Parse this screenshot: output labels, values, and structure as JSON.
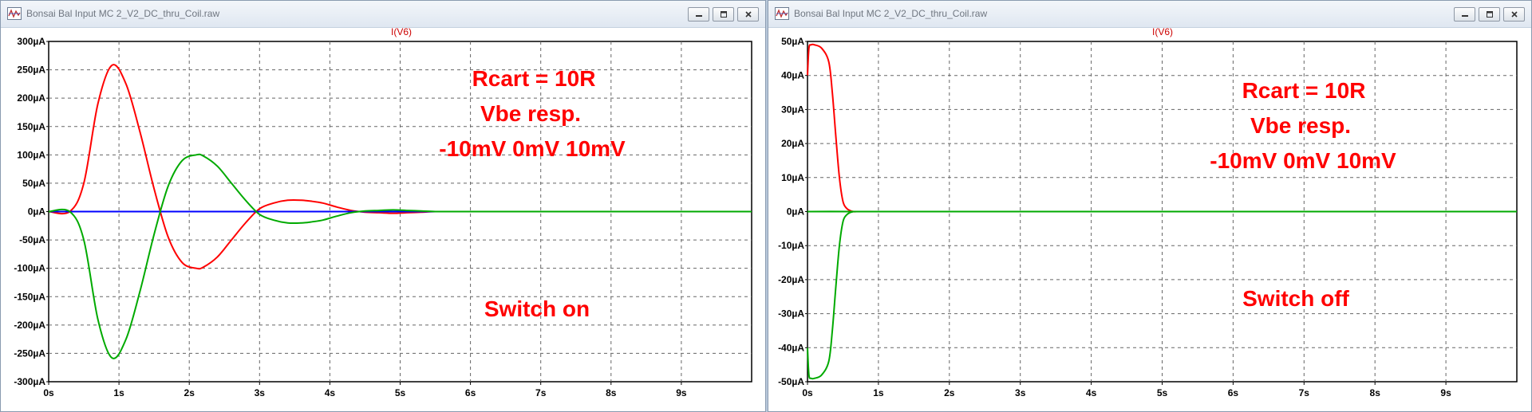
{
  "windows": [
    {
      "id": "left",
      "title": "Bonsai Bal Input MC 2_V2_DC_thru_Coil.raw",
      "trace": "I(V6)",
      "annotations": {
        "line1": "Rcart = 10R",
        "line2": "Vbe resp.",
        "line3": "-10mV  0mV 10mV",
        "state": "Switch on"
      },
      "chart_data": {
        "type": "line",
        "title": "I(V6)",
        "xlabel": "",
        "ylabel": "",
        "xlim": [
          0,
          10
        ],
        "ylim": [
          -300,
          300
        ],
        "grid": true,
        "x_ticks": [
          "0s",
          "1s",
          "2s",
          "3s",
          "4s",
          "5s",
          "6s",
          "7s",
          "8s",
          "9s"
        ],
        "y_ticks": [
          "300µA",
          "250µA",
          "200µA",
          "150µA",
          "100µA",
          "50µA",
          "0µA",
          "-50µA",
          "-100µA",
          "-150µA",
          "-200µA",
          "-250µA",
          "-300µA"
        ],
        "series": [
          {
            "color": "#ff0000",
            "x": [
              0,
              0.3,
              0.5,
              0.7,
              0.9,
              1.1,
              1.3,
              1.5,
              1.7,
              1.9,
              2.1,
              2.2,
              2.4,
              2.6,
              2.8,
              3.0,
              3.2,
              3.4,
              3.6,
              3.75,
              3.9,
              4.1,
              4.3,
              4.5,
              4.7,
              4.9,
              5.1,
              5.3,
              5.5,
              5.7,
              5.95
            ],
            "values": [
              0,
              0,
              50,
              190,
              258,
              225,
              140,
              40,
              -45,
              -90,
              -100,
              -98,
              -80,
              -50,
              -20,
              5,
              15,
              20,
              20,
              18,
              15,
              8,
              2,
              -1,
              -2,
              -3,
              -2,
              -1,
              0,
              0,
              0
            ]
          },
          {
            "color": "#0000ff",
            "x": [
              0,
              10
            ],
            "values": [
              0,
              0
            ]
          },
          {
            "color": "#00aa00",
            "x": [
              0,
              0.3,
              0.5,
              0.7,
              0.9,
              1.1,
              1.3,
              1.5,
              1.7,
              1.9,
              2.1,
              2.2,
              2.4,
              2.6,
              2.8,
              3.0,
              3.2,
              3.4,
              3.6,
              3.75,
              3.9,
              4.1,
              4.3,
              4.5,
              4.7,
              4.9,
              5.1,
              5.3,
              5.5,
              5.7,
              5.95,
              10
            ],
            "values": [
              0,
              0,
              -50,
              -190,
              -258,
              -225,
              -140,
              -40,
              45,
              90,
              100,
              98,
              80,
              50,
              20,
              -5,
              -15,
              -20,
              -20,
              -18,
              -15,
              -8,
              -2,
              1,
              2,
              3,
              2,
              1,
              0,
              0,
              0,
              0
            ]
          }
        ]
      }
    },
    {
      "id": "right",
      "title": "Bonsai Bal Input MC 2_V2_DC_thru_Coil.raw",
      "trace": "I(V6)",
      "annotations": {
        "line1": "Rcart = 10R",
        "line2": "Vbe resp.",
        "line3": "-10mV  0mV 10mV",
        "state": "Switch off"
      },
      "chart_data": {
        "type": "line",
        "title": "I(V6)",
        "xlabel": "",
        "ylabel": "",
        "xlim": [
          0,
          10
        ],
        "ylim": [
          -50,
          50
        ],
        "grid": true,
        "x_ticks": [
          "0s",
          "1s",
          "2s",
          "3s",
          "4s",
          "5s",
          "6s",
          "7s",
          "8s",
          "9s"
        ],
        "y_ticks": [
          "50µA",
          "40µA",
          "30µA",
          "20µA",
          "10µA",
          "0µA",
          "-10µA",
          "-20µA",
          "-30µA",
          "-40µA",
          "-50µA"
        ],
        "series": [
          {
            "color": "#ff0000",
            "x": [
              0,
              0.02,
              0.05,
              0.1,
              0.2,
              0.3,
              0.35,
              0.4,
              0.45,
              0.5,
              0.55,
              0.6,
              0.65,
              0.7
            ],
            "values": [
              40,
              48,
              49,
              49,
              48,
              44,
              35,
              22,
              10,
              3,
              1,
              0.3,
              0,
              0
            ]
          },
          {
            "color": "#0000ff",
            "x": [
              0,
              0.7
            ],
            "values": [
              0,
              0
            ]
          },
          {
            "color": "#00aa00",
            "x": [
              0,
              0.02,
              0.05,
              0.1,
              0.2,
              0.3,
              0.35,
              0.4,
              0.45,
              0.5,
              0.55,
              0.6,
              0.65,
              0.7,
              10
            ],
            "values": [
              -40,
              -48,
              -49,
              -49,
              -48,
              -44,
              -35,
              -22,
              -10,
              -3,
              -1,
              -0.3,
              0,
              0,
              0
            ]
          }
        ]
      }
    }
  ]
}
